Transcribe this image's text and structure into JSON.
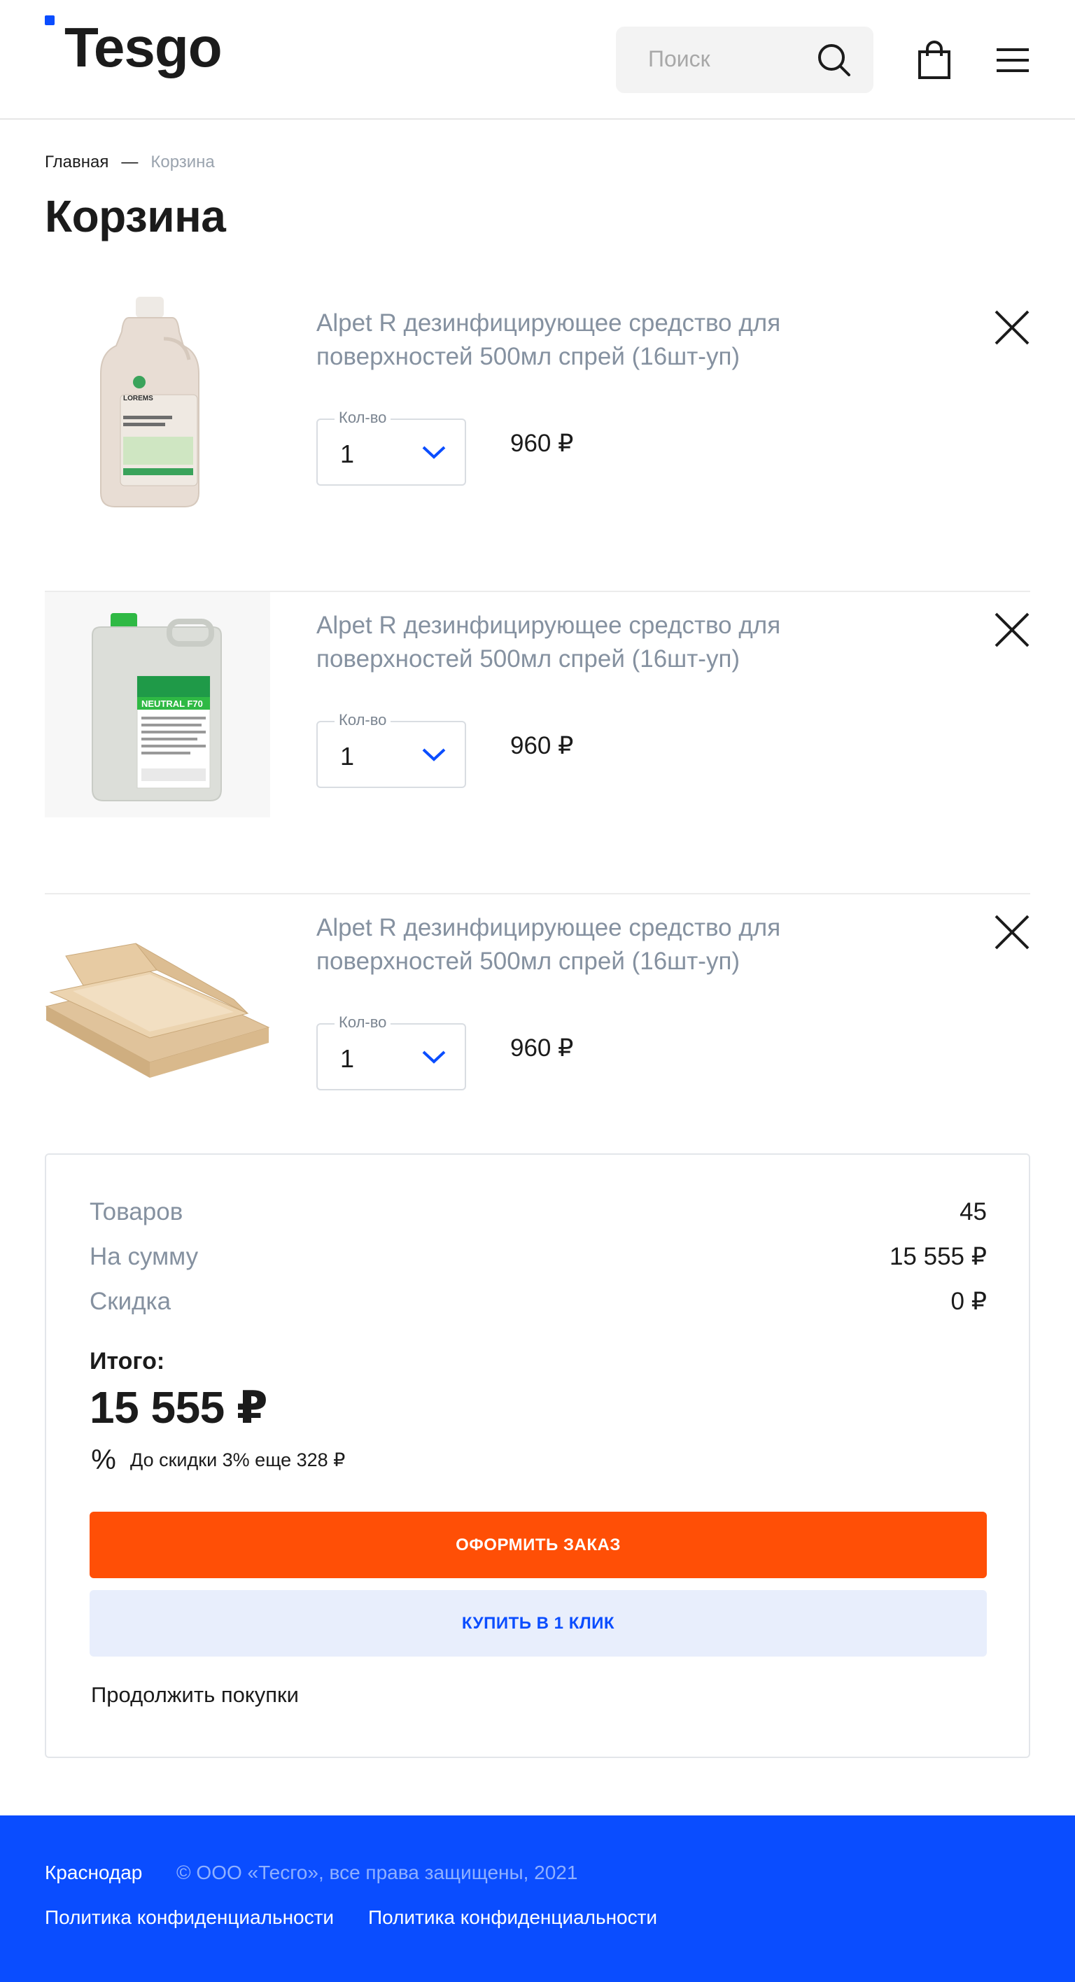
{
  "header": {
    "logo_text": "Tesgo",
    "search_placeholder": "Поиск",
    "icons": [
      "search-icon",
      "cart-icon",
      "menu-icon"
    ]
  },
  "breadcrumb": {
    "home": "Главная",
    "separator": "—",
    "current": "Корзина"
  },
  "page_title": "Корзина",
  "cart": {
    "items": [
      {
        "name": "Alpet R дезинфицирующее средство для поверхностей 500мл спрей (16шт-уп)",
        "qty_label": "Кол-во",
        "qty": "1",
        "price": "960 ₽",
        "image": "white-bottle"
      },
      {
        "name": "Alpet R дезинфицирующее средство для поверхностей 500мл спрей (16шт-уп)",
        "qty_label": "Кол-во",
        "qty": "1",
        "price": "960 ₽",
        "image": "canister-neutral-f70",
        "image_label": "NEUTRAL F70"
      },
      {
        "name": "Alpet R дезинфицирующее средство для поверхностей 500мл спрей (16шт-уп)",
        "qty_label": "Кол-во",
        "qty": "1",
        "price": "960 ₽",
        "image": "pizza-boxes"
      }
    ]
  },
  "summary": {
    "goods_label": "Товаров",
    "goods_value": "45",
    "sum_label": "На сумму",
    "sum_value": "15 555 ₽",
    "discount_label": "Скидка",
    "discount_value": "0 ₽",
    "total_label": "Итого:",
    "total_value": "15 555 ₽",
    "percent_symbol": "%",
    "discount_hint": "До скидки 3% еще 328 ₽",
    "order_button": "ОФОРМИТЬ ЗАКАЗ",
    "oneclick_button": "КУПИТЬ В 1 КЛИК",
    "continue_link": "Продолжить покупки"
  },
  "footer": {
    "city": "Краснодар",
    "copyright": "© ООО «Тесго», все права защищены, 2021",
    "link1": "Политика конфиденциальности",
    "link2": "Политика конфиденциальности"
  },
  "colors": {
    "accent_blue": "#0a4dff",
    "order_orange": "#ff4f06",
    "oneclick_bg": "#e8eefc",
    "muted_text": "#8591a0"
  }
}
